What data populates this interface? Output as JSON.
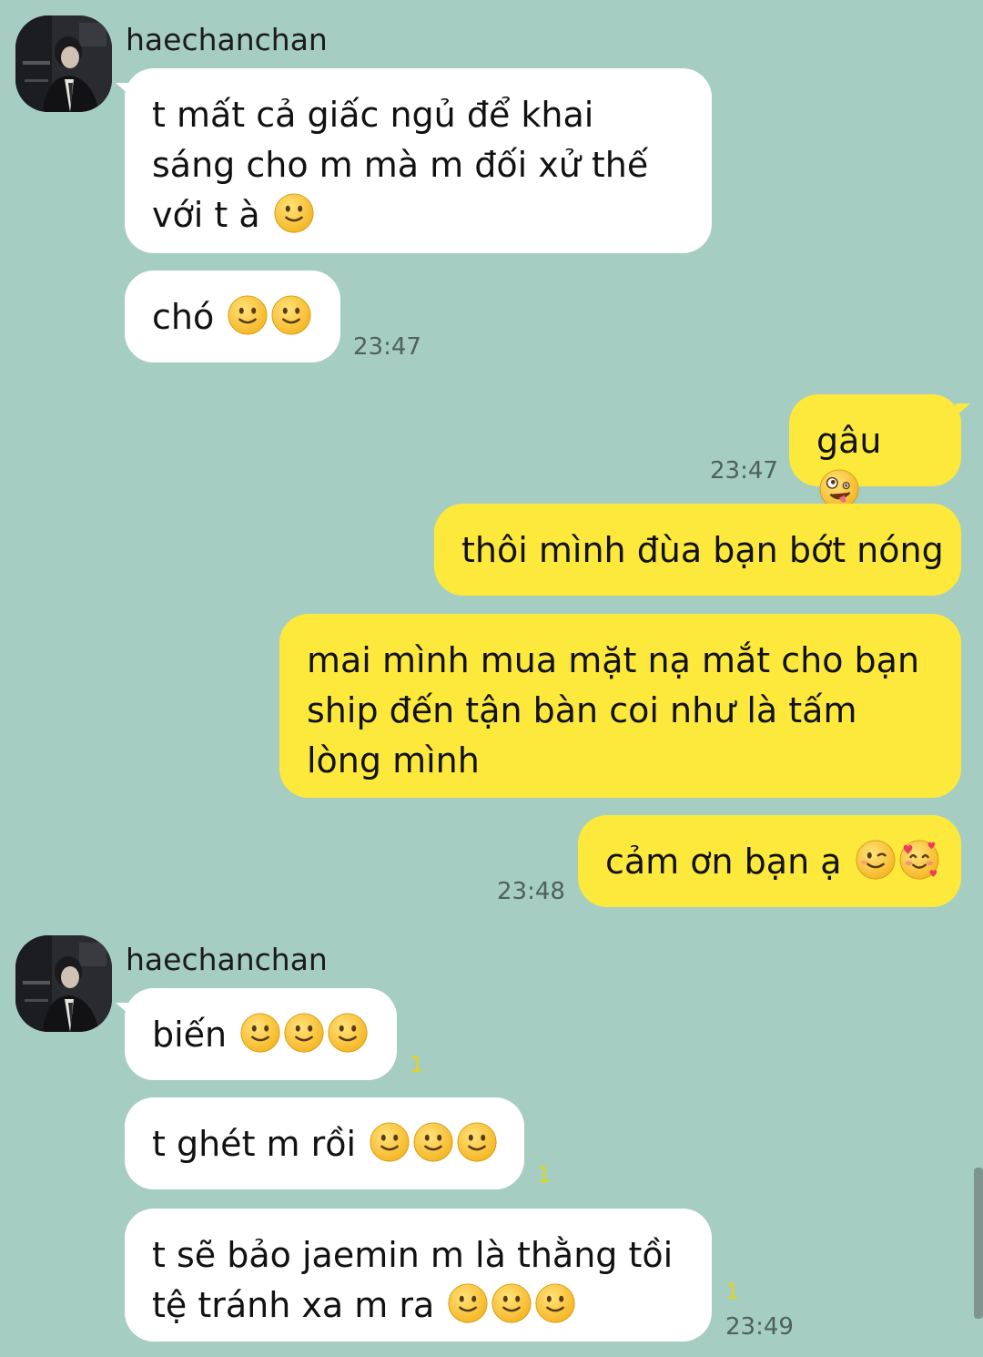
{
  "chat": {
    "sender_name": "haechanchan",
    "groups": [
      {
        "messages": [
          {
            "text": "t mất cả giấc ngủ để khai sáng cho m mà m đối xử thế với t à",
            "emoji": [
              "slightly-smiling-face"
            ]
          },
          {
            "text": "chó",
            "emoji": [
              "slightly-smiling-face",
              "slightly-smiling-face"
            ],
            "time": "23:47"
          }
        ]
      },
      {
        "messages": [
          {
            "text": "gâu",
            "emoji": [
              "zany-face"
            ],
            "time": "23:47"
          },
          {
            "text": "thôi mình đùa bạn bớt nóng"
          },
          {
            "text": "mai mình mua mặt nạ mắt cho bạn ship đến tận bàn coi như là tấm lòng mình"
          },
          {
            "text": "cảm ơn bạn ạ",
            "emoji": [
              "winking-face",
              "smiling-face-with-hearts"
            ],
            "time": "23:48"
          }
        ]
      },
      {
        "messages": [
          {
            "text": "biến",
            "emoji": [
              "slightly-smiling-face",
              "slightly-smiling-face",
              "slightly-smiling-face"
            ],
            "unread": "1"
          },
          {
            "text": "t ghét m rồi",
            "emoji": [
              "slightly-smiling-face",
              "slightly-smiling-face",
              "slightly-smiling-face"
            ],
            "unread": "1"
          },
          {
            "text": "t sẽ bảo jaemin m là thằng tồi tệ tránh xa m ra",
            "emoji": [
              "slightly-smiling-face",
              "slightly-smiling-face",
              "slightly-smiling-face"
            ],
            "unread": "1",
            "time": "23:49"
          }
        ]
      }
    ]
  },
  "colors": {
    "background": "#a6cdc2",
    "incoming_bubble": "#ffffff",
    "outgoing_bubble": "#fde93c",
    "unread_count": "#e2d419"
  }
}
